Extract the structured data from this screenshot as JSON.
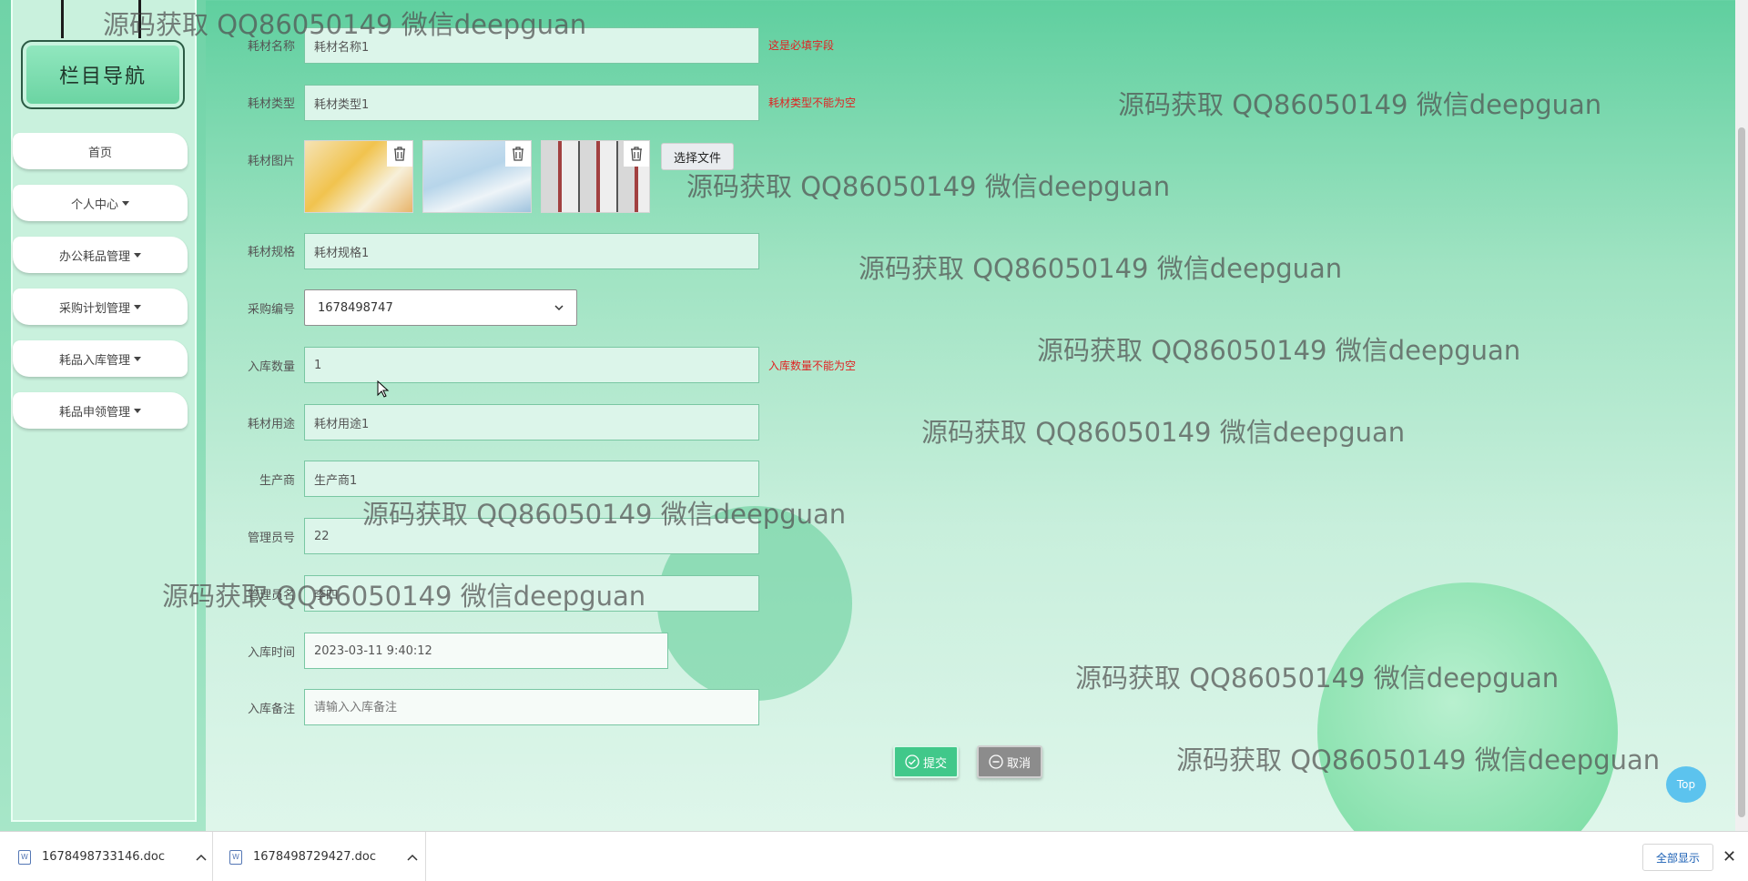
{
  "sidebar": {
    "title": "栏目导航",
    "items": [
      {
        "label": "首页",
        "dropdown": false
      },
      {
        "label": "个人中心",
        "dropdown": true
      },
      {
        "label": "办公耗品管理",
        "dropdown": true
      },
      {
        "label": "采购计划管理",
        "dropdown": true
      },
      {
        "label": "耗品入库管理",
        "dropdown": true
      },
      {
        "label": "耗品申领管理",
        "dropdown": true
      }
    ]
  },
  "form": {
    "name": {
      "label": "耗材名称",
      "value": "耗材名称1",
      "error": "这是必填字段"
    },
    "type": {
      "label": "耗材类型",
      "value": "耗材类型1",
      "error": "耗材类型不能为空"
    },
    "image": {
      "label": "耗材图片",
      "choose_file": "选择文件"
    },
    "spec": {
      "label": "耗材规格",
      "value": "耗材规格1"
    },
    "purchase_no": {
      "label": "采购编号",
      "value": "1678498747"
    },
    "quantity": {
      "label": "入库数量",
      "value": "1",
      "error": "入库数量不能为空"
    },
    "usage": {
      "label": "耗材用途",
      "value": "耗材用途1"
    },
    "manufacturer": {
      "label": "生产商",
      "value": "生产商1"
    },
    "admin_no": {
      "label": "管理员号",
      "value": "22"
    },
    "admin_name": {
      "label": "管理员名",
      "value": "李四"
    },
    "time": {
      "label": "入库时间",
      "value": "2023-03-11 9:40:12"
    },
    "remark": {
      "label": "入库备注",
      "placeholder": "请输入入库备注"
    }
  },
  "buttons": {
    "submit": "提交",
    "cancel": "取消",
    "top": "Top"
  },
  "watermark": "源码获取 QQ86050149 微信deepguan",
  "downloads": {
    "items": [
      "1678498733146.doc",
      "1678498729427.doc"
    ],
    "show_all": "全部显示"
  },
  "colors": {
    "accent": "#41c88a",
    "error": "#e02222",
    "background": "#9fe3c2"
  }
}
